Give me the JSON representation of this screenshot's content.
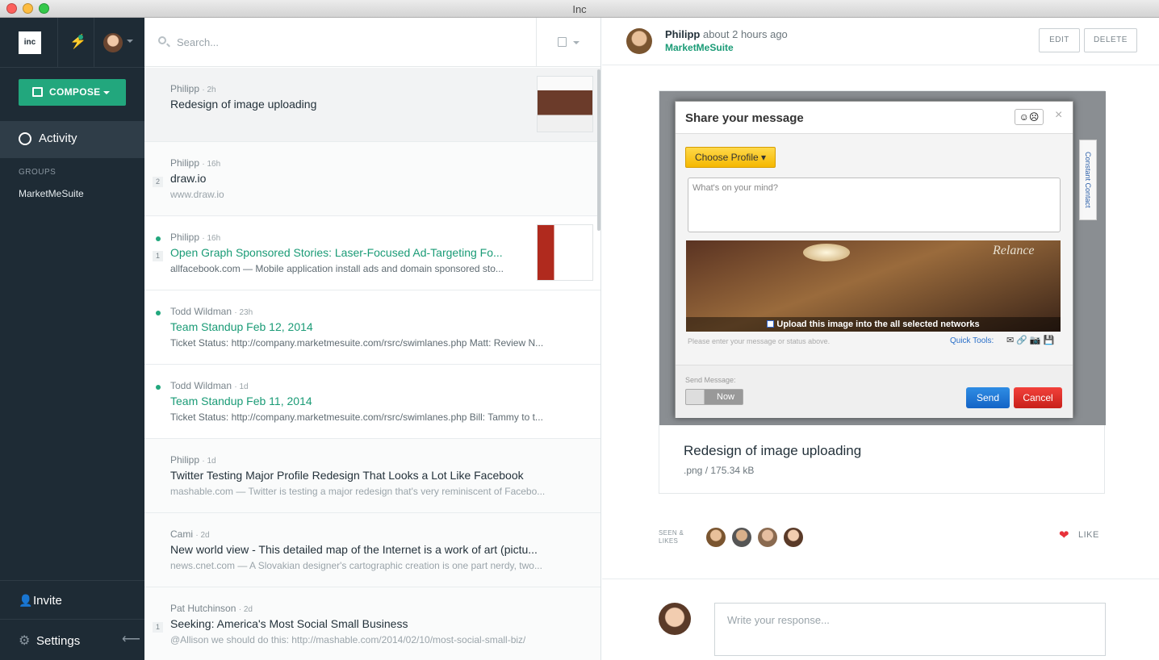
{
  "window": {
    "title": "Inc"
  },
  "sidebar": {
    "logo_text": "inc",
    "compose_label": "COMPOSE",
    "activity_label": "Activity",
    "groups_heading": "GROUPS",
    "groups": [
      "MarketMeSuite"
    ],
    "invite_label": "Invite",
    "settings_label": "Settings"
  },
  "search": {
    "placeholder": "Search..."
  },
  "feed": [
    {
      "author": "Philipp",
      "ago": "2h",
      "title": "Redesign of image uploading",
      "subtitle": "",
      "unread": false,
      "count": "",
      "link": false,
      "thumb": true,
      "state": "sel"
    },
    {
      "author": "Philipp",
      "ago": "16h",
      "title": "draw.io",
      "subtitle": "www.draw.io",
      "unread": false,
      "count": "2",
      "link": false,
      "thumb": false,
      "state": "read"
    },
    {
      "author": "Philipp",
      "ago": "16h",
      "title": "Open Graph Sponsored Stories: Laser-Focused Ad-Targeting Fo...",
      "subtitle": "allfacebook.com — Mobile application install ads and domain sponsored sto...",
      "unread": true,
      "count": "1",
      "link": true,
      "thumb": true,
      "state": ""
    },
    {
      "author": "Todd Wildman",
      "ago": "23h",
      "title": "Team Standup Feb 12, 2014",
      "subtitle": "Ticket Status: http://company.marketmesuite.com/rsrc/swimlanes.php Matt: Review N...",
      "unread": true,
      "count": "",
      "link": true,
      "thumb": false,
      "state": ""
    },
    {
      "author": "Todd Wildman",
      "ago": "1d",
      "title": "Team Standup Feb 11, 2014",
      "subtitle": "Ticket Status: http://company.marketmesuite.com/rsrc/swimlanes.php Bill: Tammy to t...",
      "unread": true,
      "count": "",
      "link": true,
      "thumb": false,
      "state": ""
    },
    {
      "author": "Philipp",
      "ago": "1d",
      "title": "Twitter Testing Major Profile Redesign That Looks a Lot Like Facebook",
      "subtitle": "mashable.com — Twitter is testing a major redesign that's very reminiscent of Facebo...",
      "unread": false,
      "count": "",
      "link": false,
      "thumb": false,
      "state": "read"
    },
    {
      "author": "Cami",
      "ago": "2d",
      "title": "New world view - This detailed map of the Internet is a work of art (pictu...",
      "subtitle": "news.cnet.com — A Slovakian designer's cartographic creation is one part nerdy, two...",
      "unread": false,
      "count": "",
      "link": false,
      "thumb": false,
      "state": "read"
    },
    {
      "author": "Pat Hutchinson",
      "ago": "2d",
      "title": "Seeking: America's Most Social Small Business",
      "subtitle": "@Allison we should do this: http://mashable.com/2014/02/10/most-social-small-biz/",
      "unread": false,
      "count": "1",
      "link": false,
      "thumb": false,
      "state": "read"
    }
  ],
  "detail": {
    "author": "Philipp",
    "ago": "about 2 hours ago",
    "group": "MarketMeSuite",
    "edit_label": "EDIT",
    "delete_label": "DELETE",
    "file_title": "Redesign of image uploading",
    "file_meta": ".png / 175.34 kB",
    "seen_label_1": "SEEN &",
    "seen_label_2": "LIKES",
    "like_label": "LIKE",
    "reply_placeholder": "Write your response..."
  },
  "screenshot": {
    "dialog_title": "Share your message",
    "choose_profile": "Choose Profile ▾",
    "mind_placeholder": "What's on your mind?",
    "watermark": "Relance",
    "upload_label": "Upload this image into the all selected networks",
    "hint": "Please enter your message or status above.",
    "quick_tools": "Quick Tools:",
    "send_message": "Send Message:",
    "toggle": "Now",
    "send": "Send",
    "cancel": "Cancel",
    "side_tab": "Constant Contact"
  },
  "colors": {
    "accent": "#22a77d",
    "sidebar": "#1e2b35",
    "like": "#e8313a"
  }
}
